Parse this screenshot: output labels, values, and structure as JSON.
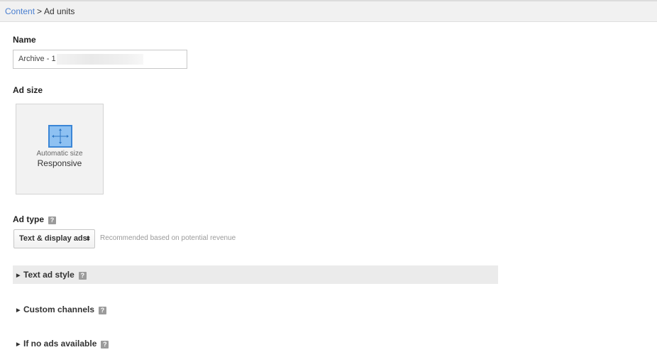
{
  "breadcrumb": {
    "parent": "Content",
    "separator": ">",
    "current": "Ad units"
  },
  "name": {
    "label": "Name",
    "value": "Archive - 1"
  },
  "ad_size": {
    "label": "Ad size",
    "option": {
      "caption": "Automatic size",
      "title": "Responsive",
      "icon": "resize-arrows-icon"
    }
  },
  "ad_type": {
    "label": "Ad type",
    "help": "?",
    "selected": "Text & display ads",
    "select_arrows": "⬍",
    "hint": "Recommended based on potential revenue"
  },
  "sections": [
    {
      "label": "Text ad style",
      "help": "?",
      "arrow": "▶"
    },
    {
      "label": "Custom channels",
      "help": "?",
      "arrow": "▶"
    },
    {
      "label": "If no ads available",
      "help": "?",
      "arrow": "▶"
    }
  ],
  "colors": {
    "link": "#4a7fd0",
    "icon_fill": "#8ec1f2",
    "icon_border": "#3b86d6",
    "section_bg": "#ebebeb"
  }
}
